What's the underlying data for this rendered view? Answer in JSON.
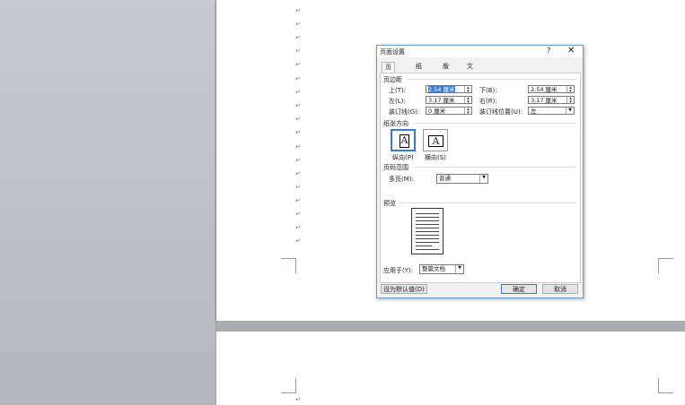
{
  "dialog": {
    "title": "页面设置",
    "help_label": "?",
    "close_label": "✕",
    "tabs": [
      "页边距",
      "纸张",
      "版式",
      "文档网格"
    ],
    "margins": {
      "section": "页边距",
      "top_label": "上(T):",
      "top_value": "2.54 厘米",
      "bottom_label": "下(B):",
      "bottom_value": "2.54 厘米",
      "left_label": "左(L):",
      "left_value": "3.17 厘米",
      "right_label": "右(R):",
      "right_value": "3.17 厘米",
      "gutter_label": "装订线(G):",
      "gutter_value": "0 厘米",
      "gutter_pos_label": "装订线位置(U):",
      "gutter_pos_value": "左"
    },
    "orientation": {
      "section": "纸张方向",
      "portrait_label": "纵向(P)",
      "landscape_label": "横向(S)",
      "glyph": "A"
    },
    "pages": {
      "section": "页码范围",
      "multiple_label": "多页(M):",
      "multiple_value": "普通"
    },
    "preview": {
      "section": "预览"
    },
    "apply": {
      "label": "应用于(Y):",
      "value": "整篇文档"
    },
    "default_button": "设为默认值(D)",
    "ok_button": "确定",
    "cancel_button": "取消"
  },
  "document": {
    "paragraph_mark": "↵"
  },
  "icons": {
    "spin": "spin-arrows-icon",
    "dropdown": "chevron-down-icon"
  },
  "colors": {
    "accent": "#3b7bd1",
    "dialog_border": "#6aa0d6"
  }
}
